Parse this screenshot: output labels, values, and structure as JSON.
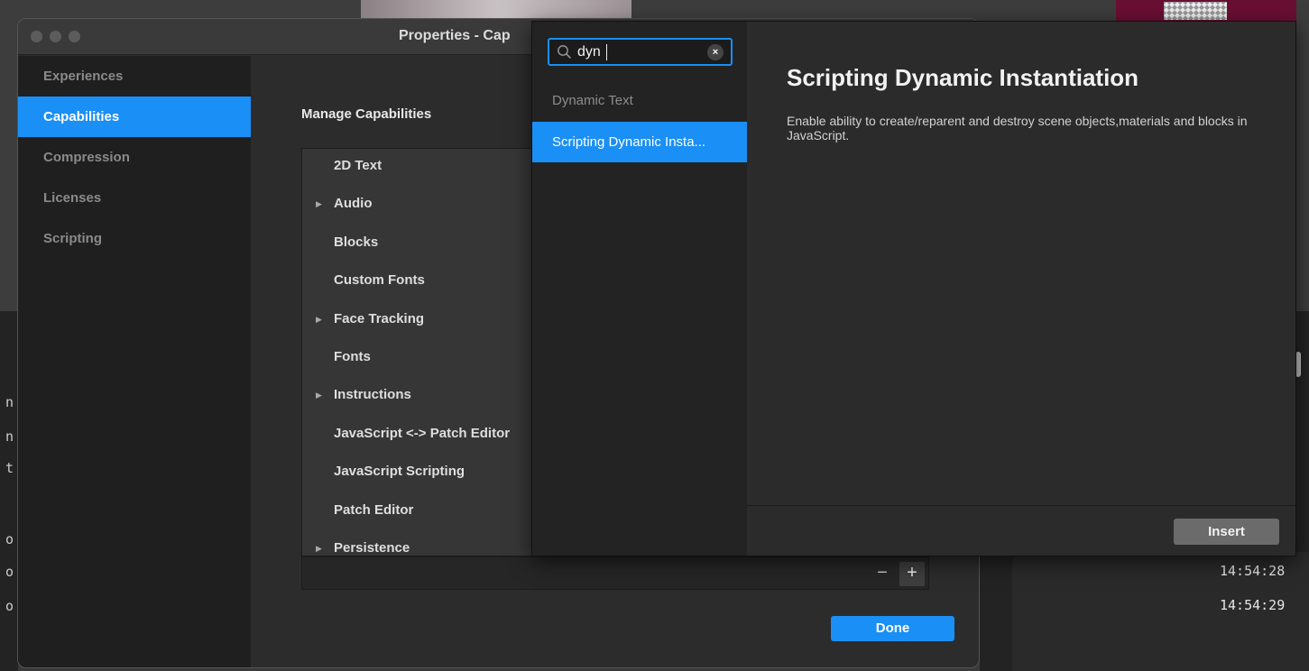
{
  "window": {
    "title": "Properties - Cap"
  },
  "sidebar": {
    "items": [
      {
        "label": "Experiences"
      },
      {
        "label": "Capabilities",
        "active": true
      },
      {
        "label": "Compression"
      },
      {
        "label": "Licenses"
      },
      {
        "label": "Scripting"
      }
    ]
  },
  "main": {
    "section_title": "Manage Capabilities",
    "capabilities": [
      {
        "label": "2D Text",
        "expandable": false
      },
      {
        "label": "Audio",
        "expandable": true
      },
      {
        "label": "Blocks",
        "expandable": false
      },
      {
        "label": "Custom Fonts",
        "expandable": false
      },
      {
        "label": "Face Tracking",
        "expandable": true
      },
      {
        "label": "Fonts",
        "expandable": false
      },
      {
        "label": "Instructions",
        "expandable": true
      },
      {
        "label": "JavaScript <-> Patch Editor",
        "expandable": false
      },
      {
        "label": "JavaScript Scripting",
        "expandable": false
      },
      {
        "label": "Patch Editor",
        "expandable": false
      },
      {
        "label": "Persistence",
        "expandable": true
      }
    ],
    "remove_label": "−",
    "add_label": "+",
    "done_label": "Done"
  },
  "popover": {
    "search": {
      "value": "dyn",
      "clear_label": "×"
    },
    "results": [
      {
        "label": "Dynamic Text",
        "selected": false
      },
      {
        "label": "Scripting Dynamic Insta...",
        "selected": true
      }
    ],
    "detail": {
      "title": "Scripting Dynamic Instantiation",
      "description": "Enable ability to create/reparent and destroy scene objects,materials and blocks in JavaScript."
    },
    "insert_label": "Insert"
  },
  "background": {
    "timestamps": [
      "14:54:28",
      "14:54:29"
    ],
    "left_chars": [
      "n",
      "n",
      "t",
      "o",
      "o",
      "o"
    ]
  },
  "colors": {
    "accent": "#1a8ff5",
    "sidebar_bg": "#1f1f1f",
    "list_bg": "#363636",
    "insert_bg": "#6b6b6b"
  }
}
